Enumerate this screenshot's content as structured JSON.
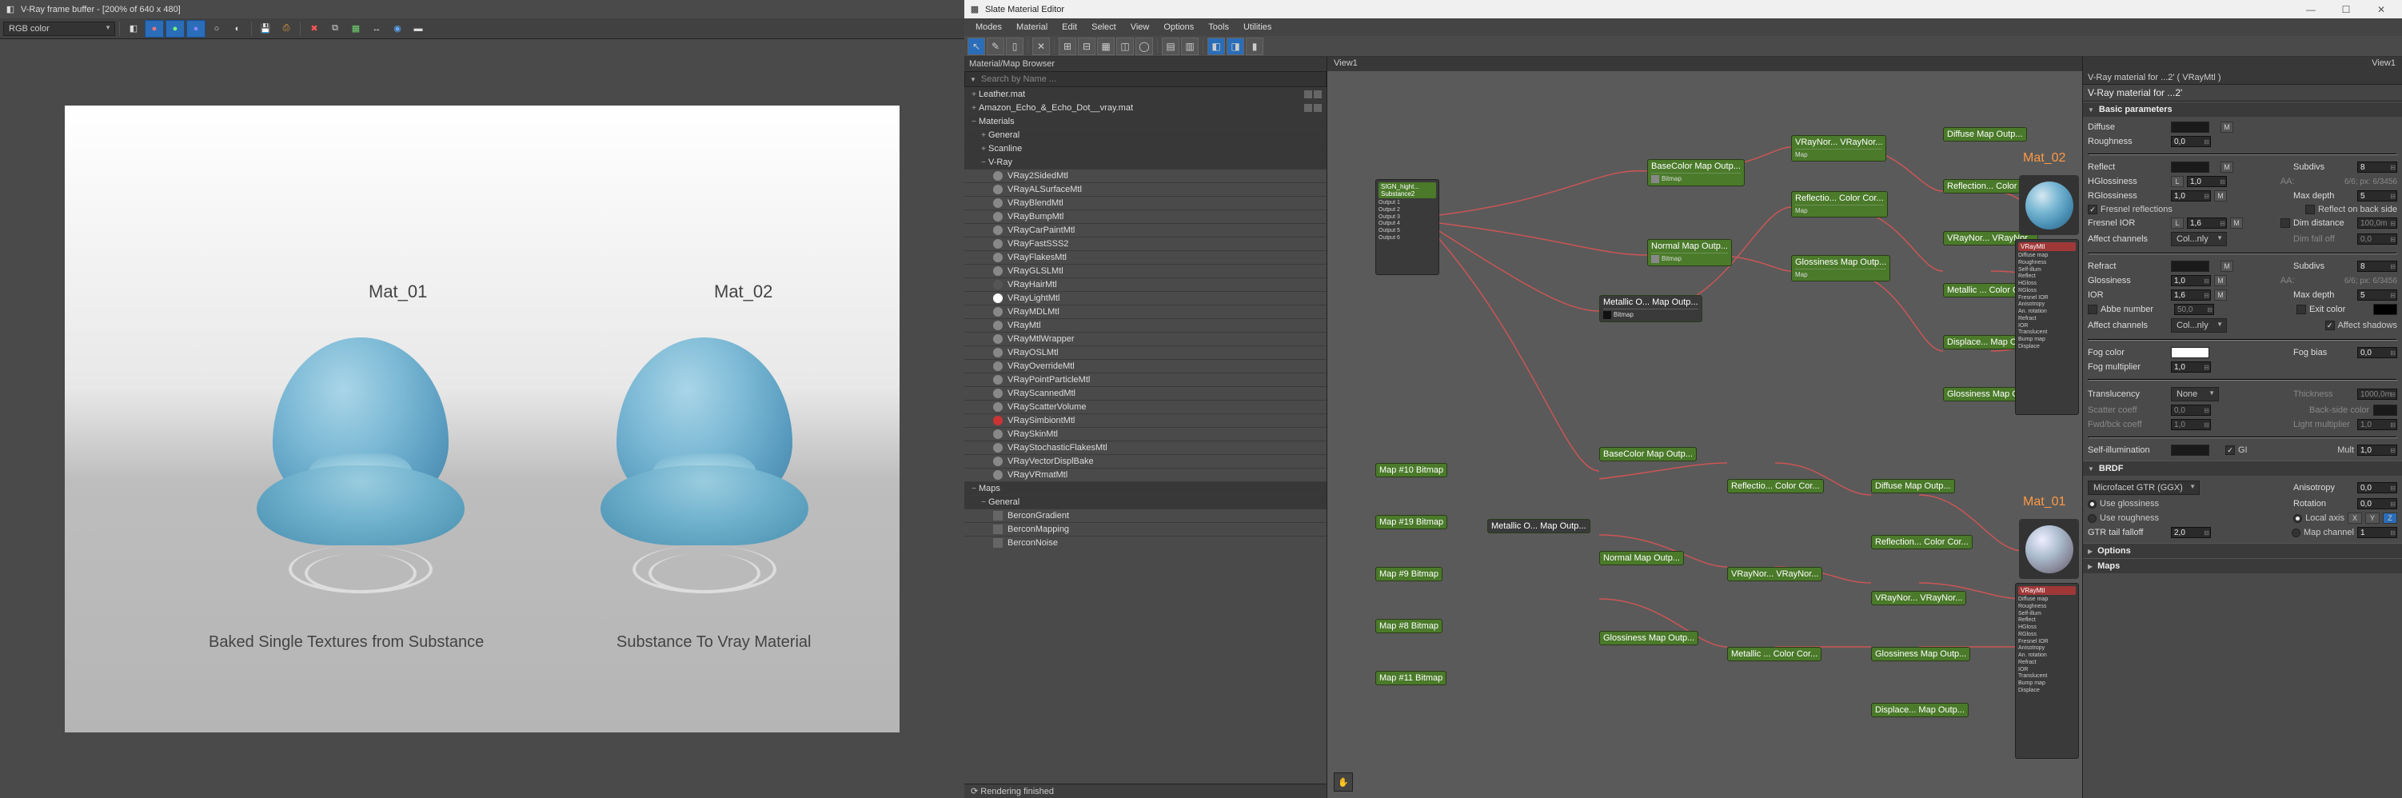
{
  "vfb": {
    "title": "V-Ray frame buffer - [200% of 640 x 480]",
    "channel_dropdown": "RGB color",
    "render_labels": {
      "mat01": "Mat_01",
      "mat02": "Mat_02",
      "caption_left": "Baked Single Textures from Substance",
      "caption_right": "Substance To Vray Material"
    }
  },
  "sme": {
    "title": "Slate Material Editor",
    "menus": [
      "Modes",
      "Material",
      "Edit",
      "Select",
      "View",
      "Options",
      "Tools",
      "Utilities"
    ],
    "browser_header": "Material/Map Browser",
    "search_placeholder": "Search by Name ...",
    "tree": {
      "leather": "Leather.mat",
      "amazon": "Amazon_Echo_&_Echo_Dot__vray.mat",
      "materials": "Materials",
      "general": "General",
      "scanline": "Scanline",
      "vray": "V-Ray",
      "vray_items": [
        "VRay2SidedMtl",
        "VRayALSurfaceMtl",
        "VRayBlendMtl",
        "VRayBumpMtl",
        "VRayCarPaintMtl",
        "VRayFastSSS2",
        "VRayFlakesMtl",
        "VRayGLSLMtl",
        "VRayHairMtl",
        "VRayLightMtl",
        "VRayMDLMtl",
        "VRayMtl",
        "VRayMtlWrapper",
        "VRayOSLMtl",
        "VRayOverrideMtl",
        "VRayPointParticleMtl",
        "VRayScannedMtl",
        "VRayScatterVolume",
        "VRaySimbiontMtl",
        "VRaySkinMtl",
        "VRayStochasticFlakesMtl",
        "VRayVectorDisplBake",
        "VRayVRmatMtl"
      ],
      "maps": "Maps",
      "maps_general": "General",
      "maps_items": [
        "BerconGradient",
        "BerconMapping",
        "BerconNoise"
      ]
    },
    "status": "Rendering finished",
    "view_name": "View1",
    "mat_labels": {
      "a": "Mat_02",
      "b": "Mat_01"
    },
    "nodes": {
      "sign": "SIGN_hight...\nSubstance2",
      "basecolor": "BaseColor\nMap Outp...",
      "normal": "Normal\nMap Outp...",
      "metallic": "Metallic O...\nMap Outp...",
      "glossiness": "Glossiness\nMap Outp...",
      "diffuse": "Diffuse\nMap Outp...",
      "reflection": "Reflection...\nColor Cor...",
      "displace": "Displace...\nMap Outp...",
      "vraynor": "VRayNor...\nVRayNor...",
      "refl_colc": "Reflectio...\nColor Cor...",
      "metallic2": "Metallic ...\nColor Cor...",
      "maps_bitmap": "Map #10\nBitmap",
      "map11": "Map #11\nBitmap",
      "map19": "Map #19\nBitmap",
      "map9": "Map #9\nBitmap",
      "map8": "Map #8\nBitmap"
    },
    "params": {
      "header": "V-Ray material for ...2' ( VRayMtl )",
      "title": "V-Ray material for ...2'",
      "rollouts": {
        "basic": "Basic parameters",
        "brdf": "BRDF",
        "options": "Options",
        "maps": "Maps"
      },
      "labels": {
        "diffuse": "Diffuse",
        "roughness": "Roughness",
        "reflect": "Reflect",
        "hglossiness": "HGlossiness",
        "rglossiness": "RGlossiness",
        "fresnel_refl": "Fresnel reflections",
        "fresnel_ior": "Fresnel IOR",
        "affect_channels": "Affect channels",
        "refract": "Refract",
        "glossiness": "Glossiness",
        "ior": "IOR",
        "abbe": "Abbe number",
        "affect_shadows": "Affect shadows",
        "fog_color": "Fog color",
        "fog_bias": "Fog bias",
        "fog_mult": "Fog multiplier",
        "translucency": "Translucency",
        "scatter": "Scatter coeff",
        "fwdback": "Fwd/bck coeff",
        "thickness": "Thickness",
        "backside": "Back-side color",
        "light_mult": "Light multiplier",
        "selfillum": "Self-illumination",
        "gi": "GI",
        "mult": "Mult",
        "subdivs": "Subdivs",
        "aa": "AA:",
        "max_depth": "Max depth",
        "refl_back": "Reflect on back side",
        "dim_dist": "Dim distance",
        "dim_falloff": "Dim fall off",
        "exit_color": "Exit color",
        "brdf_type": "Microfacet GTR (GGX)",
        "use_gloss": "Use glossiness",
        "use_rough": "Use roughness",
        "gtr_falloff": "GTR tail falloff",
        "anisotropy": "Anisotropy",
        "rotation": "Rotation",
        "local_axis": "Local axis",
        "map_channel": "Map channel",
        "col_only": "Col...nly",
        "none": "None",
        "L": "L",
        "M": "M"
      },
      "values": {
        "roughness": "0,0",
        "hgloss": "1,0",
        "rgloss": "1,0",
        "fresnel_ior": "1,6",
        "refr_gloss": "1,0",
        "ior": "1,6",
        "abbe": "50,0",
        "fog_bias": "0,0",
        "fog_mult": "1,0",
        "scatter": "0,0",
        "fwdback": "1,0",
        "thickness": "1000,0m",
        "light_mult": "1,0",
        "mult": "1,0",
        "subdivs": "8",
        "aa_detail": "6/6; px: 6/3456",
        "max_depth": "5",
        "dim_dist": "100,0m",
        "dim_fall": "0,0",
        "gtr": "2,0",
        "aniso": "0,0",
        "rotation": "0,0",
        "map_ch": "1"
      },
      "colors": {
        "diffuse": "#1a1a1a",
        "reflect": "#1a1a1a",
        "refract": "#1a1a1a",
        "fog": "#ffffff",
        "backside": "#1a1a1a",
        "selfillum": "#1a1a1a"
      }
    }
  }
}
